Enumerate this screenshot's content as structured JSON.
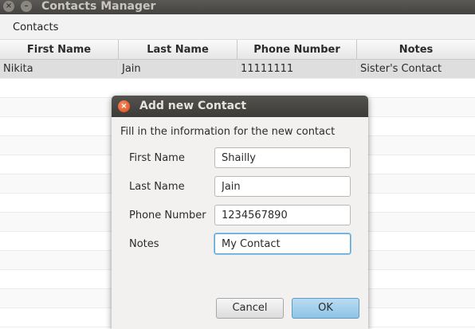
{
  "window": {
    "title": "Contacts Manager",
    "close_glyph": "×",
    "minimize_glyph": "–"
  },
  "menubar": {
    "items": [
      {
        "label": "Contacts"
      }
    ]
  },
  "table": {
    "columns": [
      {
        "label": "First Name"
      },
      {
        "label": "Last Name"
      },
      {
        "label": "Phone Number"
      },
      {
        "label": "Notes"
      }
    ],
    "rows": [
      {
        "first": "Nikita",
        "last": "Jain",
        "phone": "11111111",
        "notes": "Sister's Contact"
      }
    ]
  },
  "dialog": {
    "title": "Add new Contact",
    "close_glyph": "×",
    "header": "Fill in the information for the new contact",
    "fields": [
      {
        "label": "First Name",
        "value": "Shailly"
      },
      {
        "label": "Last Name",
        "value": "Jain"
      },
      {
        "label": "Phone Number",
        "value": "1234567890"
      },
      {
        "label": "Notes",
        "value": "My Contact"
      }
    ],
    "cancel_label": "Cancel",
    "ok_label": "OK"
  },
  "colors": {
    "title_bar": "#44433f",
    "dialog_close": "#df4a16",
    "focus_ring": "#5fa8d3",
    "ok_button": "#8fc3e6"
  }
}
